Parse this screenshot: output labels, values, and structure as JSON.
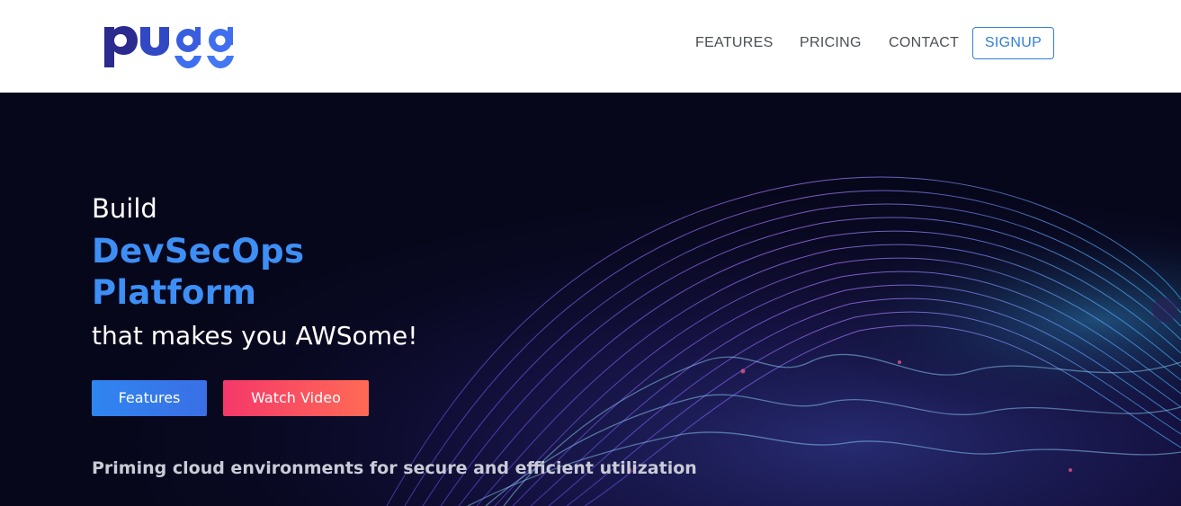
{
  "brand": {
    "logo_text": "pugg",
    "colors": {
      "logo_dark": "#2b2a8f",
      "logo_light": "#3f6ff0",
      "accent": "#3d8ff5",
      "signup_border": "#2f7fd8",
      "features_button": "#2f86f0",
      "video_button": "#f5386a",
      "hero_background": "#07071c"
    }
  },
  "nav": {
    "features_label": "FEATURES",
    "pricing_label": "PRICING",
    "contact_label": "CONTACT",
    "signup_label": "SIGNUP"
  },
  "hero": {
    "line1": "Build",
    "accent_line1": "DevSecOps",
    "accent_line2": "Platform",
    "tagline": "that makes you AWSome!",
    "features_button_label": "Features",
    "watch_video_button_label": "Watch Video",
    "subtitle": "Priming cloud environments for secure and efficient utilization"
  }
}
